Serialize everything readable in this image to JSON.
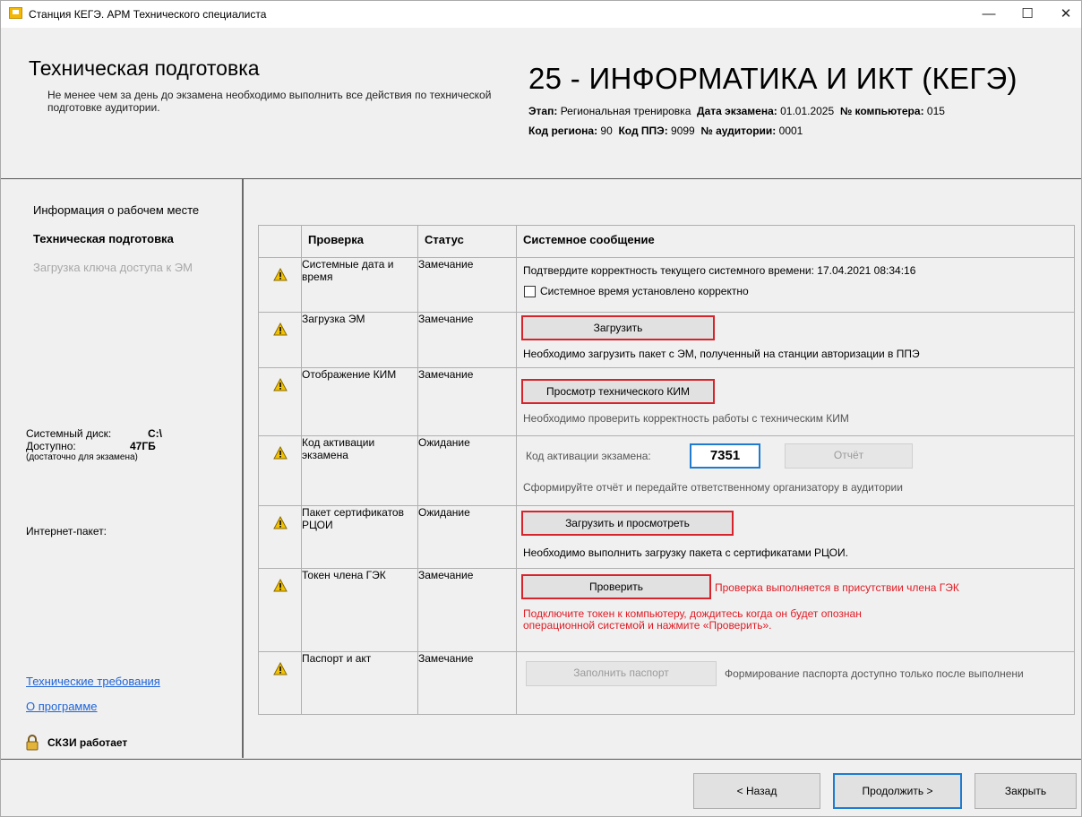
{
  "window": {
    "title": "Станция КЕГЭ. АРМ Технического специалиста"
  },
  "header": {
    "title": "Техническая подготовка",
    "description": "Не менее чем за день до экзамена необходимо выполнить все действия по технической подготовке аудитории.",
    "exam_title": "25 - ИНФОРМАТИКА И ИКТ (КЕГЭ)",
    "meta": {
      "stage_label": "Этап:",
      "stage_value": "Региональная тренировка",
      "date_label": "Дата экзамена:",
      "date_value": "01.01.2025",
      "computer_label": "№ компьютера:",
      "computer_value": "015",
      "region_label": "Код региона:",
      "region_value": "90",
      "ppe_label": "Код ППЭ:",
      "ppe_value": "9099",
      "room_label": "№ аудитории:",
      "room_value": "0001"
    }
  },
  "sidebar": {
    "nav": [
      {
        "label": "Информация о рабочем месте",
        "state": "normal"
      },
      {
        "label": "Техническая подготовка",
        "state": "active"
      },
      {
        "label": "Загрузка ключа доступа к ЭМ",
        "state": "disabled"
      }
    ],
    "disk": {
      "label": "Системный диск:",
      "value": "C:\\",
      "free_label": "Доступно:",
      "free_value": "47ГБ",
      "note": "(достаточно для экзамена)"
    },
    "internet_label": "Интернет-пакет:",
    "links": [
      "Технические требования",
      "О программе"
    ],
    "crypto_status": "СКЗИ работает"
  },
  "table": {
    "headers": [
      "Проверка",
      "Статус",
      "Системное сообщение"
    ],
    "rows": [
      {
        "check": "Системные дата и время",
        "status": "Замечание",
        "message": "Подтвердите корректность текущего системного времени: 17.04.2021 08:34:16",
        "checkbox_label": "Системное время установлено корректно"
      },
      {
        "check": "Загрузка ЭМ",
        "status": "Замечание",
        "button": "Загрузить",
        "message": "Необходимо загрузить пакет с ЭМ, полученный на станции авторизации в ППЭ"
      },
      {
        "check": "Отображение КИМ",
        "status": "Замечание",
        "button": "Просмотр технического КИМ",
        "message": "Необходимо проверить корректность работы с техническим КИМ"
      },
      {
        "check": "Код активации экзамена",
        "status": "Ожидание",
        "code_label": "Код активации экзамена:",
        "code_value": "7351",
        "button": "Отчёт",
        "message": "Сформируйте отчёт и передайте ответственному организатору в аудитории"
      },
      {
        "check": "Пакет сертификатов РЦОИ",
        "status": "Ожидание",
        "button": "Загрузить и просмотреть",
        "message": "Необходимо выполнить загрузку пакета с сертификатами РЦОИ."
      },
      {
        "check": "Токен члена ГЭК",
        "status": "Замечание",
        "button": "Проверить",
        "inline_note": "Проверка выполняется в присутствии члена ГЭК",
        "message_line1": "Подключите токен к компьютеру, дождитесь когда он будет опознан",
        "message_line2": "операционной системой и нажмите «Проверить»."
      },
      {
        "check": "Паспорт и акт",
        "status": "Замечание",
        "button": "Заполнить паспорт",
        "message": "Формирование паспорта доступно только после выполнени"
      }
    ]
  },
  "footer": {
    "back": "< Назад",
    "next": "Продолжить >",
    "close": "Закрыть"
  },
  "colors": {
    "accent_blue": "#1e7bd0",
    "alert_red": "#d7232b",
    "warning_yellow": "#f2c200"
  }
}
